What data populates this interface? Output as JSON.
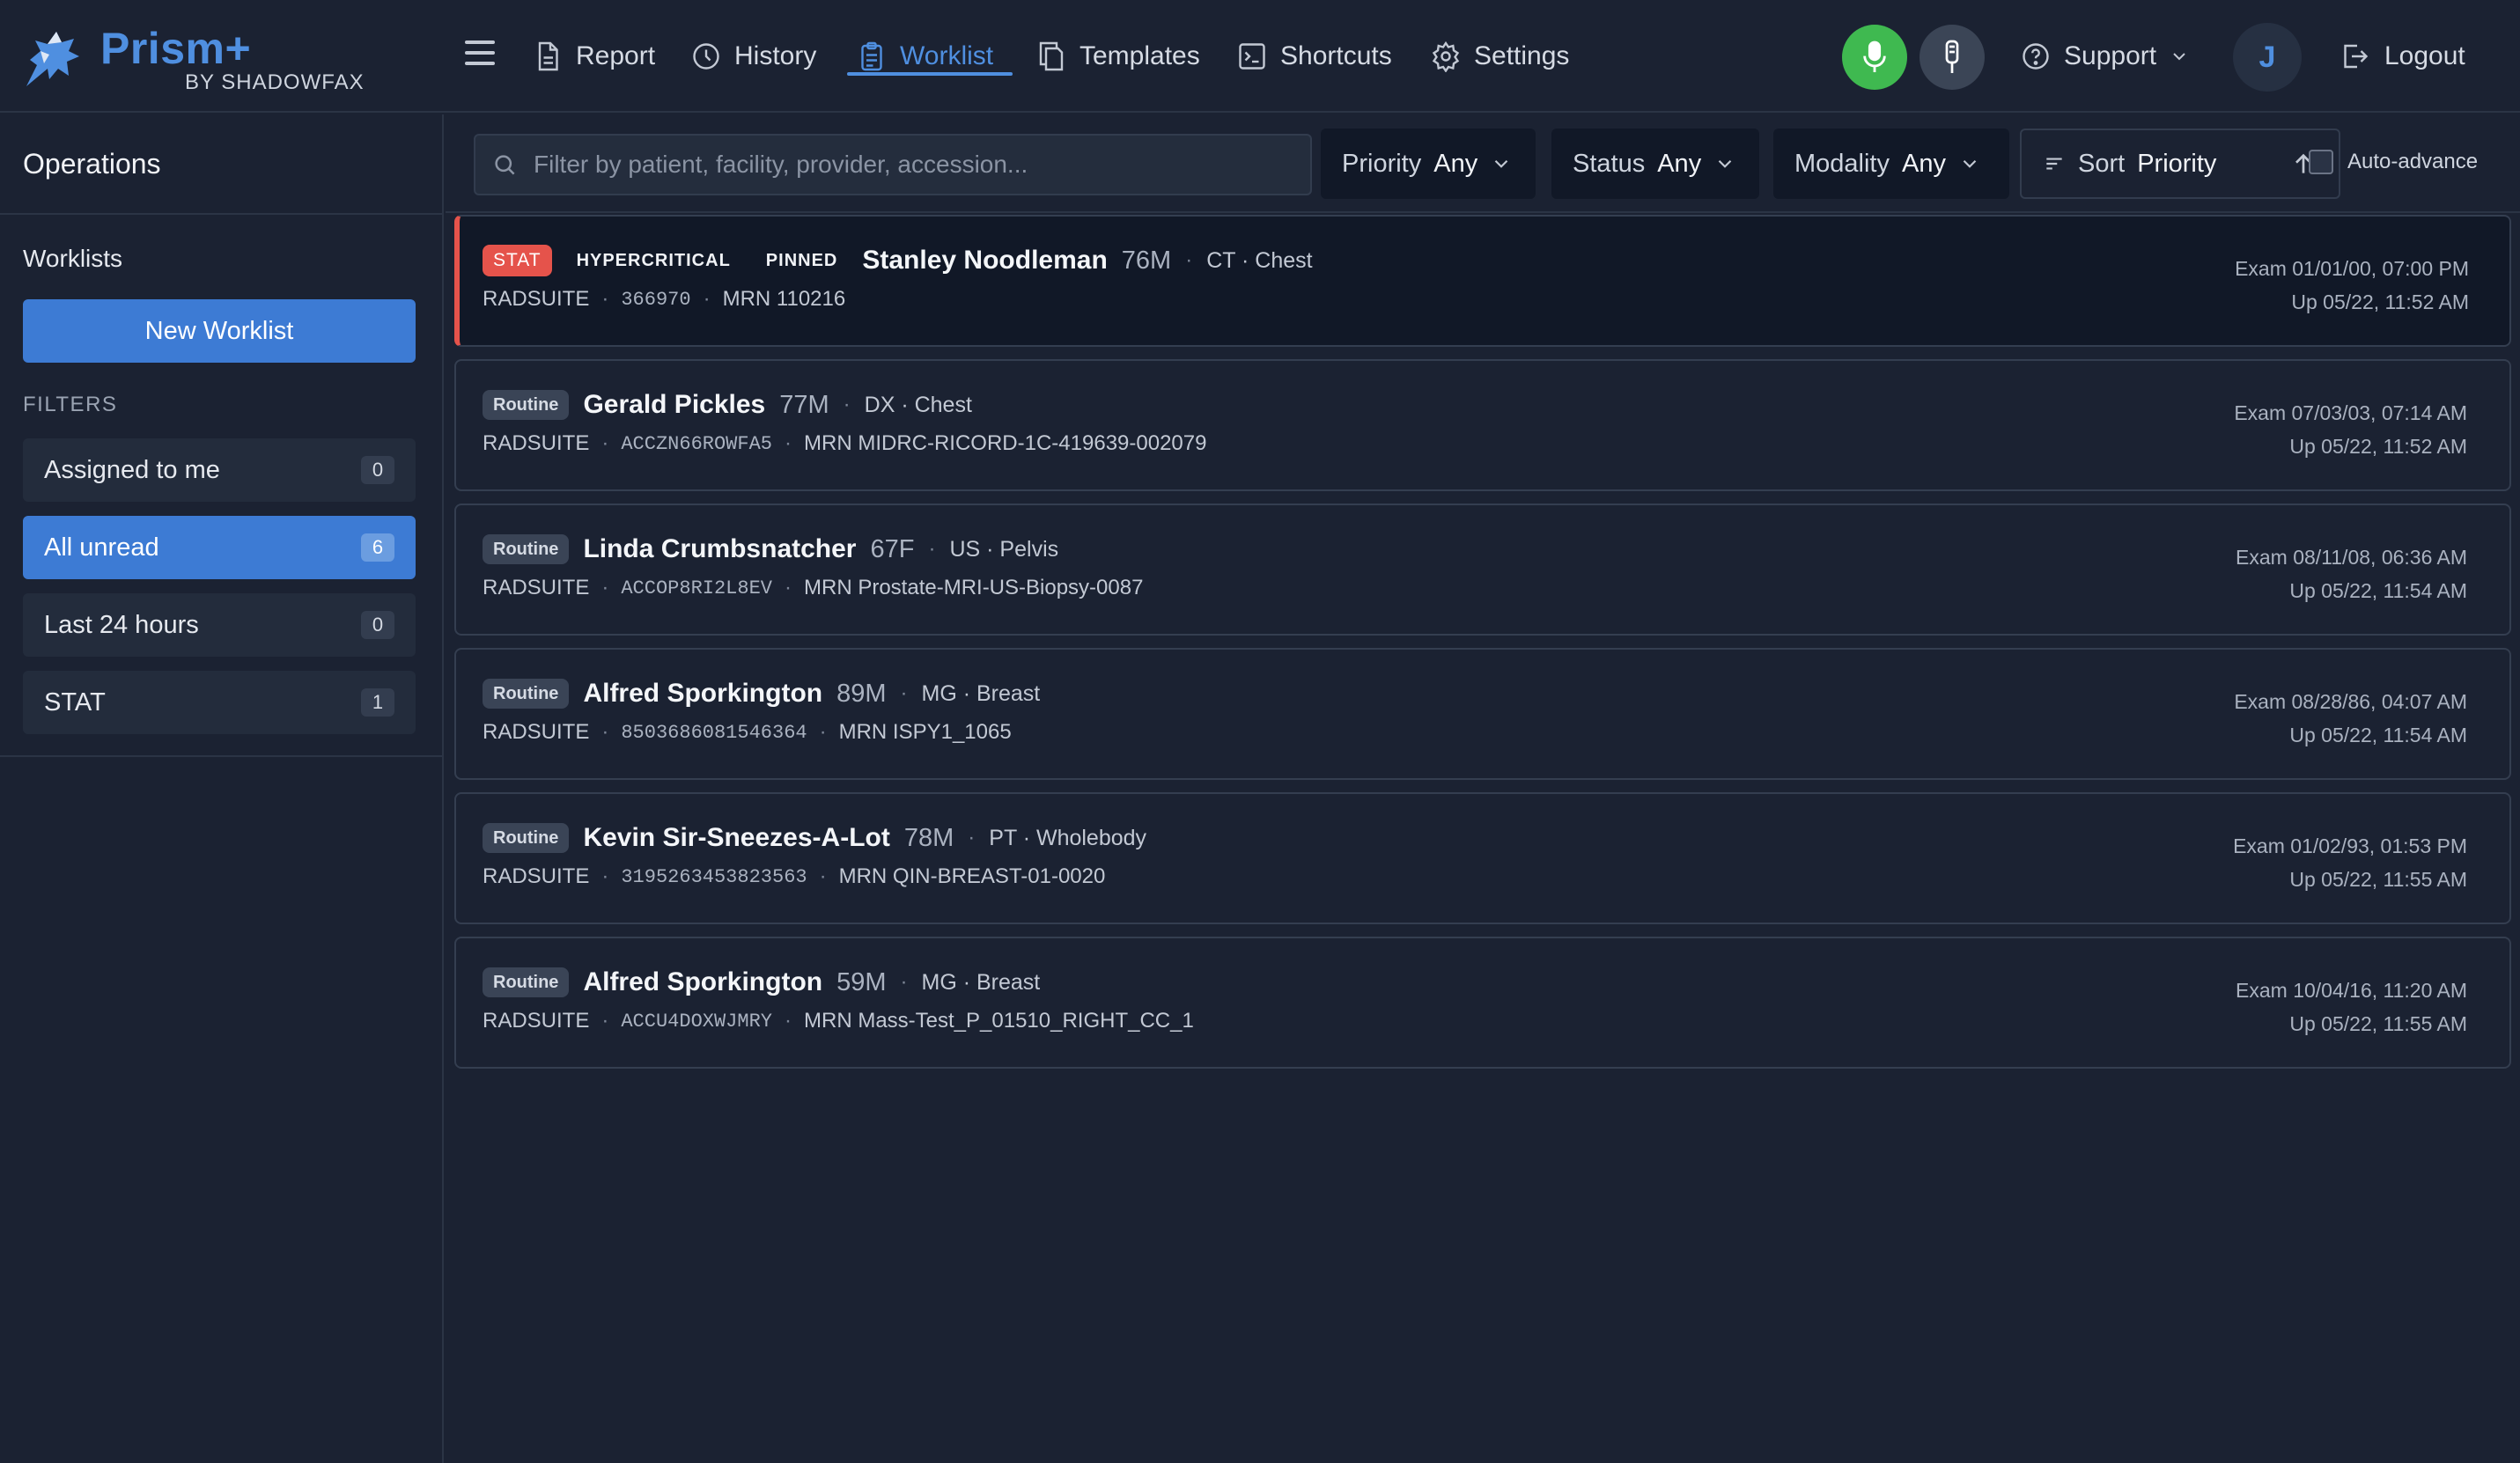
{
  "app": {
    "name": "Prism+",
    "byline": "BY SHADOWFAX"
  },
  "nav": [
    {
      "label": "Report",
      "icon": "document-icon"
    },
    {
      "label": "History",
      "icon": "clock-icon"
    },
    {
      "label": "Worklist",
      "icon": "clipboard-icon",
      "active": true
    },
    {
      "label": "Templates",
      "icon": "copy-icon"
    },
    {
      "label": "Shortcuts",
      "icon": "terminal-icon"
    },
    {
      "label": "Settings",
      "icon": "gear-icon"
    }
  ],
  "header": {
    "support_label": "Support",
    "avatar_initial": "J",
    "logout_label": "Logout",
    "mic_color": "#3fb950"
  },
  "sidebar": {
    "title": "Operations",
    "worklists_label": "Worklists",
    "new_worklist_label": "New Worklist",
    "filters_label": "FILTERS",
    "filters": [
      {
        "label": "Assigned to me",
        "count": "0"
      },
      {
        "label": "All unread",
        "count": "6",
        "active": true
      },
      {
        "label": "Last 24 hours",
        "count": "0"
      },
      {
        "label": "STAT",
        "count": "1"
      }
    ]
  },
  "filterbar": {
    "search_placeholder": "Filter by patient, facility, provider, accession...",
    "priority_label": "Priority",
    "priority_value": "Any",
    "status_label": "Status",
    "status_value": "Any",
    "modality_label": "Modality",
    "modality_value": "Any",
    "sort_label": "Sort",
    "sort_value": "Priority",
    "auto_advance_label": "Auto-advance"
  },
  "rows": [
    {
      "priority": "STAT",
      "tags": [
        "HYPERCRITICAL",
        "PINNED"
      ],
      "name": "Stanley Noodleman",
      "age_sex": "76M",
      "modality": "CT · Chest",
      "facility": "RADSUITE",
      "accession": "366970",
      "mrn": "MRN 110216",
      "exam": "Exam 01/01/00, 07:00 PM",
      "updated": "Up 05/22, 11:52 AM"
    },
    {
      "priority": "Routine",
      "tags": [],
      "name": "Gerald Pickles",
      "age_sex": "77M",
      "modality": "DX · Chest",
      "facility": "RADSUITE",
      "accession": "ACCZN66ROWFA5",
      "mrn": "MRN MIDRC-RICORD-1C-419639-002079",
      "exam": "Exam 07/03/03, 07:14 AM",
      "updated": "Up 05/22, 11:52 AM"
    },
    {
      "priority": "Routine",
      "tags": [],
      "name": "Linda Crumbsnatcher",
      "age_sex": "67F",
      "modality": "US · Pelvis",
      "facility": "RADSUITE",
      "accession": "ACCOP8RI2L8EV",
      "mrn": "MRN Prostate-MRI-US-Biopsy-0087",
      "exam": "Exam 08/11/08, 06:36 AM",
      "updated": "Up 05/22, 11:54 AM"
    },
    {
      "priority": "Routine",
      "tags": [],
      "name": "Alfred Sporkington",
      "age_sex": "89M",
      "modality": "MG · Breast",
      "facility": "RADSUITE",
      "accession": "8503686081546364",
      "mrn": "MRN ISPY1_1065",
      "exam": "Exam 08/28/86, 04:07 AM",
      "updated": "Up 05/22, 11:54 AM"
    },
    {
      "priority": "Routine",
      "tags": [],
      "name": "Kevin Sir-Sneezes-A-Lot",
      "age_sex": "78M",
      "modality": "PT · Wholebody",
      "facility": "RADSUITE",
      "accession": "3195263453823563",
      "mrn": "MRN QIN-BREAST-01-0020",
      "exam": "Exam 01/02/93, 01:53 PM",
      "updated": "Up 05/22, 11:55 AM"
    },
    {
      "priority": "Routine",
      "tags": [],
      "name": "Alfred Sporkington",
      "age_sex": "59M",
      "modality": "MG · Breast",
      "facility": "RADSUITE",
      "accession": "ACCU4DOXWJMRY",
      "mrn": "MRN Mass-Test_P_01510_RIGHT_CC_1",
      "exam": "Exam 10/04/16, 11:20 AM",
      "updated": "Up 05/22, 11:55 AM"
    }
  ]
}
